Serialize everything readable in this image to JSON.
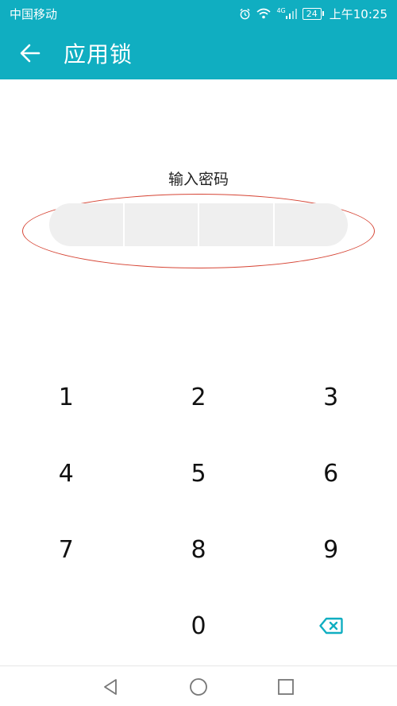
{
  "status_bar": {
    "carrier": "中国移动",
    "network": "4G",
    "battery": "24",
    "time": "上午10:25",
    "icons": [
      "alarm-icon",
      "wifi-icon",
      "signal-icon",
      "battery-icon"
    ]
  },
  "app_bar": {
    "title": "应用锁",
    "back_icon": "arrow-left-icon"
  },
  "pin": {
    "prompt": "输入密码",
    "length": 4,
    "highlight_color": "#d64434"
  },
  "keypad": {
    "keys": [
      "1",
      "2",
      "3",
      "4",
      "5",
      "6",
      "7",
      "8",
      "9",
      "",
      "0"
    ],
    "delete_icon": "backspace-icon",
    "delete_color": "#10aec1"
  },
  "nav_bar": {
    "icons": [
      "back-triangle-icon",
      "home-circle-icon",
      "recents-square-icon"
    ]
  },
  "colors": {
    "accent": "#10aec1",
    "pin_box": "#efefef"
  }
}
